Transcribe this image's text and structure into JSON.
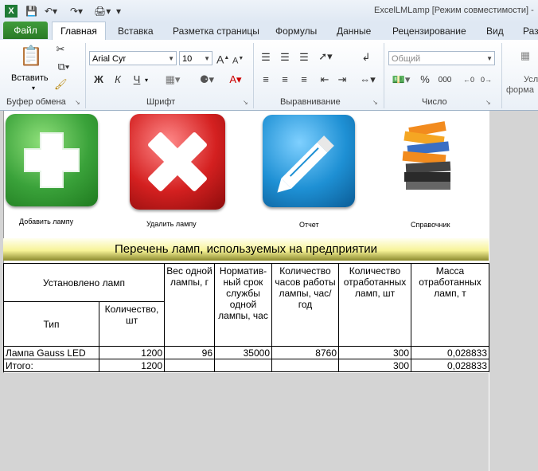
{
  "window": {
    "title": "ExcelLMLamp  [Режим совместимости]  -"
  },
  "ribbon_tabs": [
    "Файл",
    "Главная",
    "Вставка",
    "Разметка страницы",
    "Формулы",
    "Данные",
    "Рецензирование",
    "Вид",
    "Раз"
  ],
  "clipboard": {
    "paste_label": "Вставить",
    "group": "Буфер обмена"
  },
  "font": {
    "name": "Arial Cyr",
    "size": "10",
    "group": "Шрифт",
    "bold": "Ж",
    "italic": "К",
    "underline": "Ч"
  },
  "alignment": {
    "group": "Выравнивание"
  },
  "number": {
    "format": "Общий",
    "group": "Число",
    "percent": "%",
    "thousands": "000"
  },
  "styles": {
    "cut_label1": "Усл",
    "cut_label2": "форма"
  },
  "actions": [
    {
      "label": "Добавить лампу",
      "color": "#3aa23a",
      "icon": "plus-icon"
    },
    {
      "label": "Удалить лампу",
      "color": "#d42020",
      "icon": "cross-icon"
    },
    {
      "label": "Отчет",
      "color": "#1e90d4",
      "icon": "pencil-icon"
    },
    {
      "label": "Справочник",
      "icon": "binders-icon"
    }
  ],
  "banner": "Перечень ламп, используемых  на предприятии",
  "table": {
    "h_installed": "Установлено ламп",
    "h_weight": "Вес одной лампы, г",
    "h_life": "Норматив-ный срок службы одной лампы, час",
    "h_hours": "Количество часов работы лампы, час/год",
    "h_spent": "Количество отработанных ламп, шт",
    "h_mass": "Масса отработанных ламп, т",
    "h_type": "Тип",
    "h_qty": "Количество, шт",
    "rows": [
      {
        "type": "Лампа Gauss LED",
        "qty": "1200",
        "weight": "96",
        "life": "35000",
        "hours": "8760",
        "spent": "300",
        "mass": "0,028833"
      }
    ],
    "total": {
      "label": "Итого:",
      "qty": "1200",
      "spent": "300",
      "mass": "0,028833"
    }
  }
}
